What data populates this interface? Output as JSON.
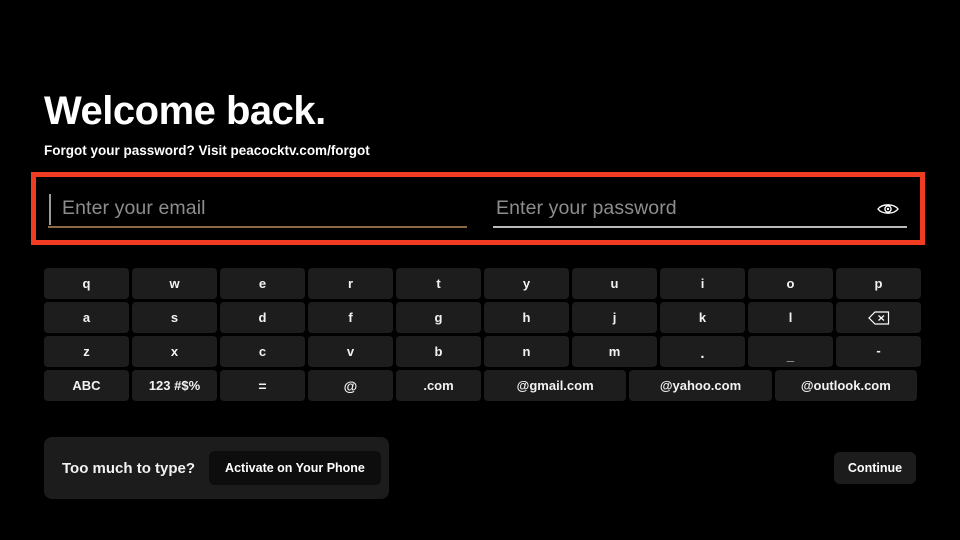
{
  "screen": {
    "background_color": "#000000",
    "focus_outline_color": "#f03c22"
  },
  "header": {
    "title": "Welcome back.",
    "subtitle": "Forgot your password? Visit peacocktv.com/forgot"
  },
  "form": {
    "email": {
      "placeholder": "Enter your email",
      "value": "",
      "underline_color": "#8a6a45",
      "focused": true
    },
    "password": {
      "placeholder": "Enter your password",
      "value": "",
      "underline_color": "#b9b9b9",
      "reveal_icon": "eye-icon"
    }
  },
  "keyboard": {
    "rows": [
      {
        "keys": [
          {
            "label": "q"
          },
          {
            "label": "w"
          },
          {
            "label": "e"
          },
          {
            "label": "r"
          },
          {
            "label": "t"
          },
          {
            "label": "y"
          },
          {
            "label": "u"
          },
          {
            "label": "i"
          },
          {
            "label": "o"
          },
          {
            "label": "p"
          }
        ]
      },
      {
        "keys": [
          {
            "label": "a"
          },
          {
            "label": "s"
          },
          {
            "label": "d"
          },
          {
            "label": "f"
          },
          {
            "label": "g"
          },
          {
            "label": "h"
          },
          {
            "label": "j"
          },
          {
            "label": "k"
          },
          {
            "label": "l"
          },
          {
            "label": "",
            "icon": "backspace-icon"
          }
        ]
      },
      {
        "keys": [
          {
            "label": "z"
          },
          {
            "label": "x"
          },
          {
            "label": "c"
          },
          {
            "label": "v"
          },
          {
            "label": "b"
          },
          {
            "label": "n"
          },
          {
            "label": "m"
          },
          {
            "label": "."
          },
          {
            "label": "_"
          },
          {
            "label": "-"
          }
        ]
      },
      {
        "keys": [
          {
            "label": "ABC"
          },
          {
            "label": "123 #$%"
          },
          {
            "label": "="
          },
          {
            "label": "@"
          },
          {
            "label": ".com"
          },
          {
            "label": "@gmail.com"
          },
          {
            "label": "@yahoo.com"
          },
          {
            "label": "@outlook.com"
          }
        ]
      }
    ]
  },
  "footer": {
    "helper_text": "Too much to type?",
    "activate_label": "Activate on Your Phone",
    "continue_label": "Continue"
  }
}
